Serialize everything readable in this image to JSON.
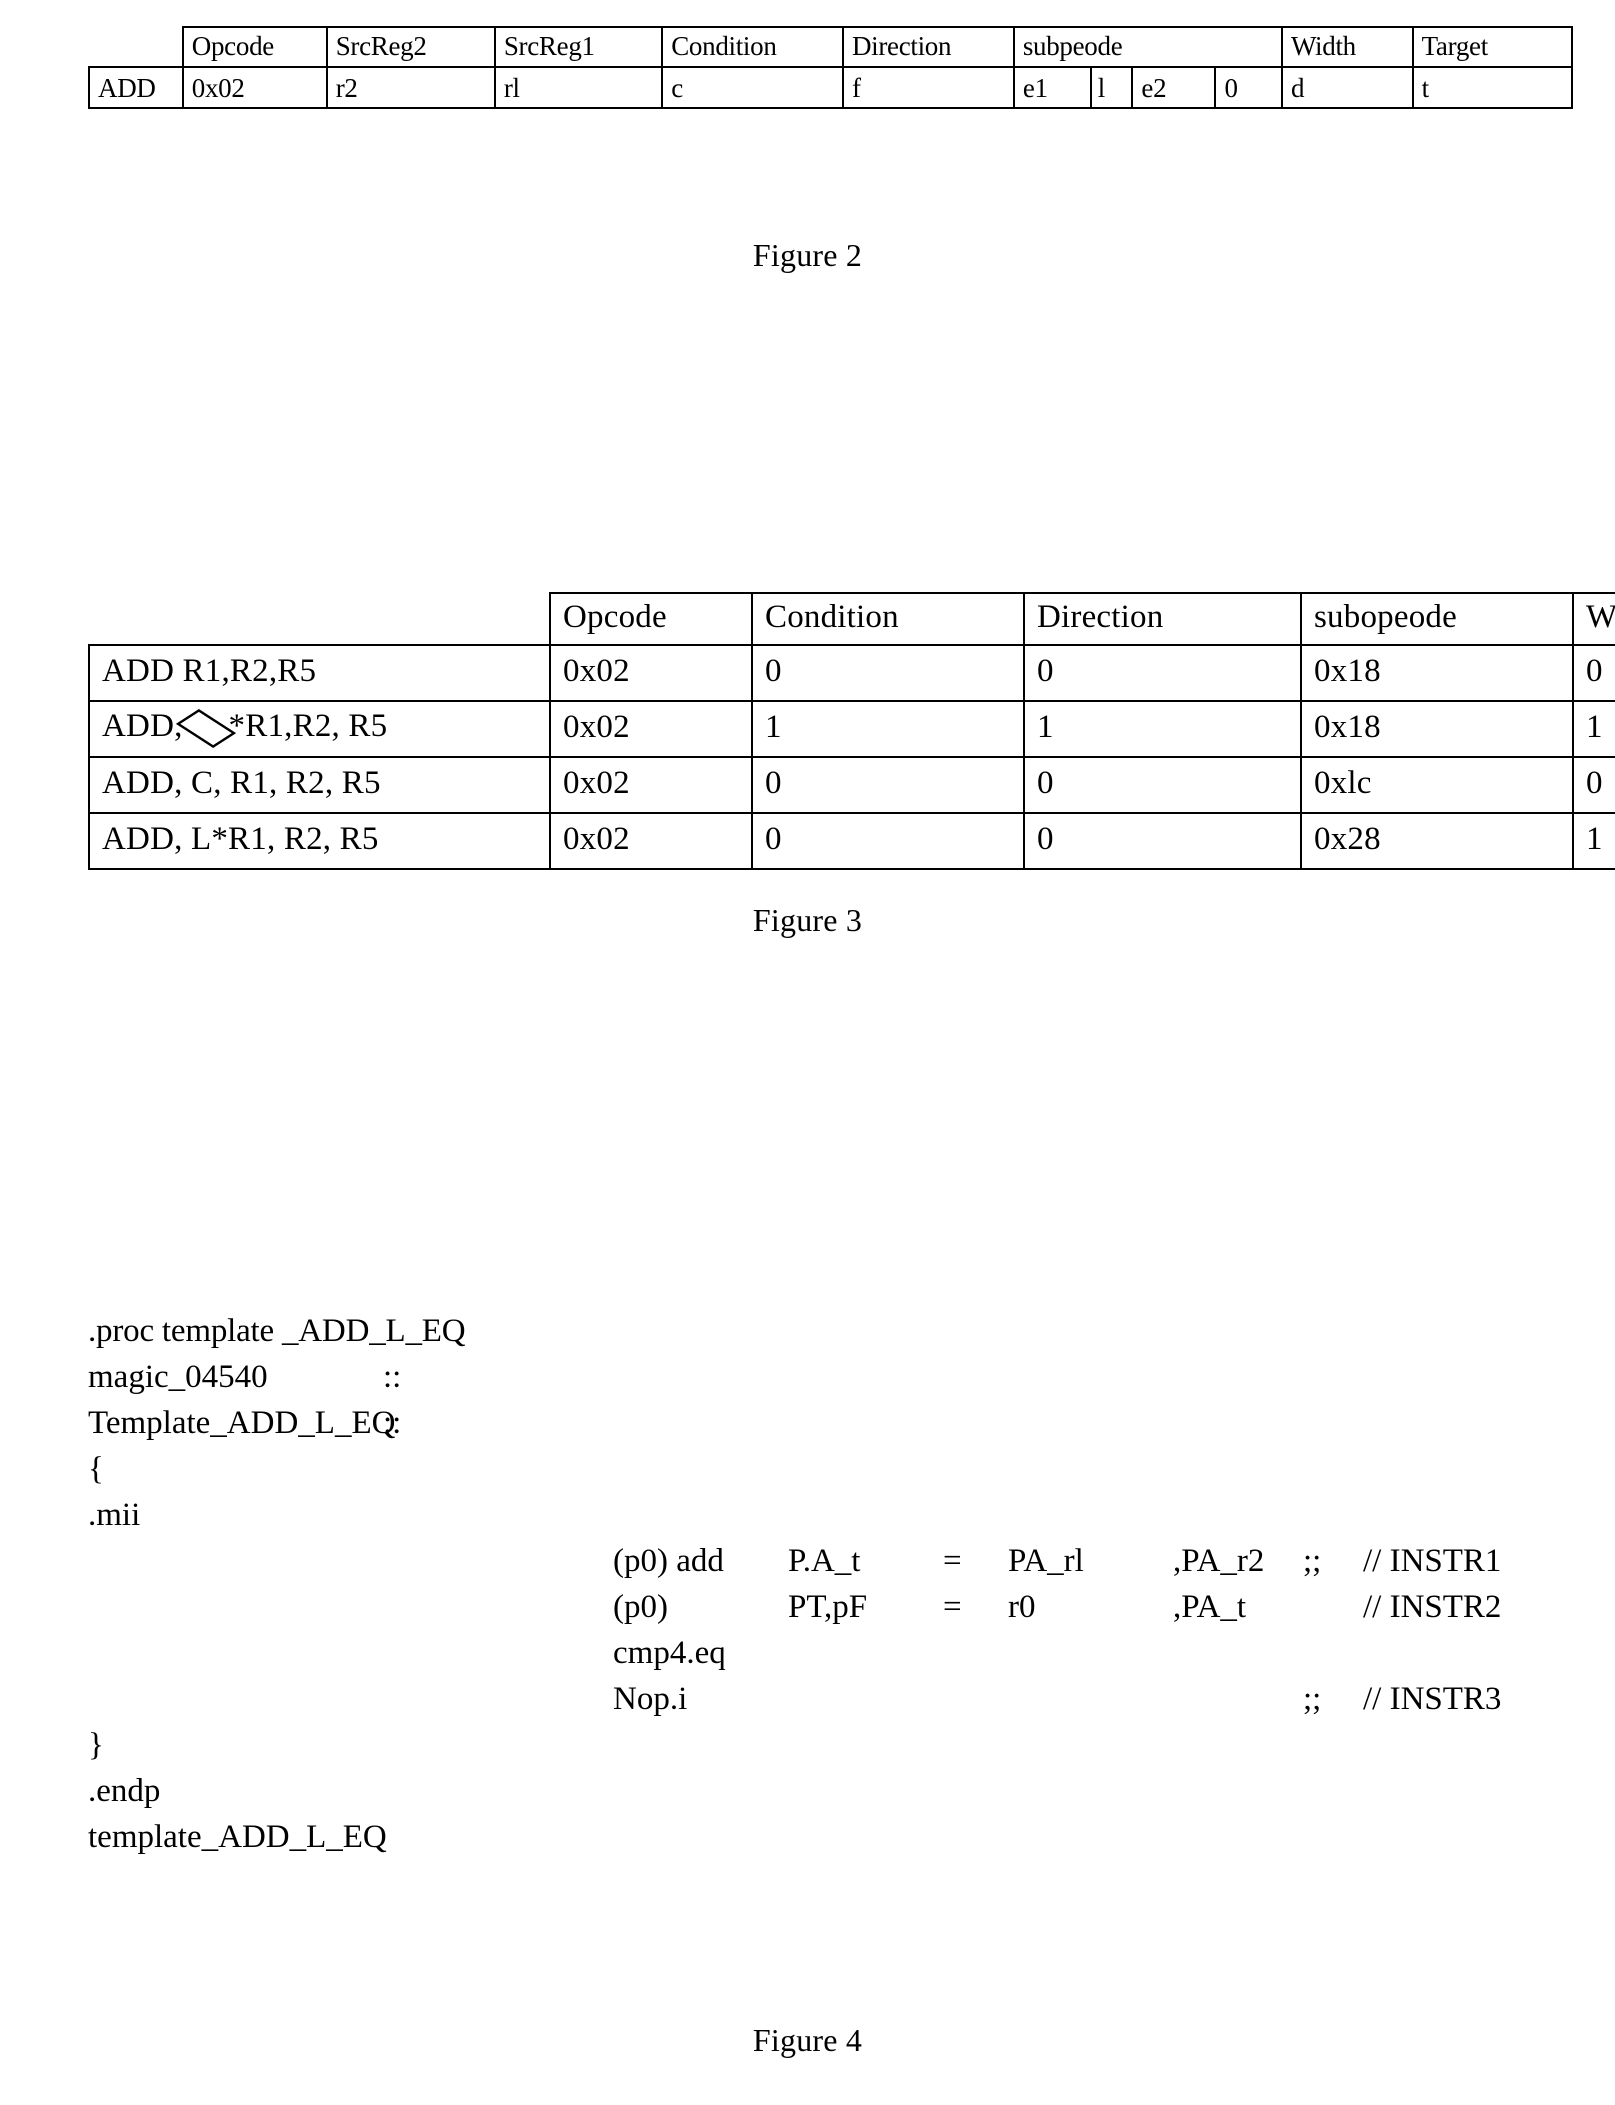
{
  "figure2": {
    "caption": "Figure 2",
    "columns": [
      "",
      "Opcode",
      "SrcReg2",
      "SrcReg1",
      "Condition",
      "Direction",
      "subpeode",
      "",
      "",
      "",
      "Width",
      "Target"
    ],
    "header": {
      "blank_left": "",
      "opcode": "Opcode",
      "srcreg2": "SrcReg2",
      "srcreg1": "SrcReg1",
      "condition": "Condition",
      "direction": "Direction",
      "subopcode": "subpeode",
      "width": "Width",
      "target": "Target"
    },
    "row": {
      "mnemonic": "ADD",
      "opcode": "0x02",
      "srcreg2": "r2",
      "srcreg1": "rl",
      "condition": "c",
      "direction": "f",
      "sub_e1": "e1",
      "sub_1": "l",
      "sub_e2": "e2",
      "sub_0": "0",
      "width": "d",
      "target": "t"
    }
  },
  "figure3": {
    "caption": "Figure 3",
    "columns": [
      "",
      "Opcode",
      "Condition",
      "Direction",
      "subopeode",
      "Width"
    ],
    "rows": [
      {
        "instruction": "ADD R1,R2,R5",
        "instruction_prefix": "ADD R1,R2,R5",
        "has_diamond": false,
        "opcode": "0x02",
        "condition": "0",
        "direction": "0",
        "subopcode": "0x18",
        "width": "0"
      },
      {
        "instruction": "ADD,  *R1,R2, R5",
        "instruction_prefix": "ADD,",
        "instruction_suffix": "*R1,R2, R5",
        "has_diamond": true,
        "opcode": "0x02",
        "condition": "1",
        "direction": "1",
        "subopcode": "0x18",
        "width": "1"
      },
      {
        "instruction": "ADD, C, R1, R2, R5",
        "instruction_prefix": "ADD, C, R1, R2, R5",
        "has_diamond": false,
        "opcode": "0x02",
        "condition": "0",
        "direction": "0",
        "subopcode": "0xlc",
        "width": "0"
      },
      {
        "instruction": "ADD, L*R1, R2, R5",
        "instruction_prefix": "ADD, L*R1, R2, R5",
        "has_diamond": false,
        "opcode": "0x02",
        "condition": "0",
        "direction": "0",
        "subopcode": "0x28",
        "width": "1"
      }
    ]
  },
  "figure4": {
    "caption": "Figure 4",
    "code_lines": [
      {
        "a": ".proc template _ADD_L_EQ"
      },
      {
        "a": "magic_04540",
        "b": "::"
      },
      {
        "a": "Template_ADD_L_EQ",
        "b": "::"
      },
      {
        "a": "{"
      },
      {
        "a": ".mii"
      },
      {
        "i1": "(p0) add",
        "i2": "P.A_t",
        "i3": "=",
        "i4": "PA_rl",
        "i5": ",PA_r2",
        "i6": ";;",
        "i7": "// INSTR1"
      },
      {
        "i1": "(p0)",
        "i2": "PT,pF",
        "i3": "=",
        "i4": "r0",
        "i5": ",PA_t",
        "i7": "// INSTR2"
      },
      {
        "i1": "cmp4.eq"
      },
      {
        "i1": "Nop.i",
        "i6": ";;",
        "i7": "// INSTR3"
      },
      {
        "a": "}"
      },
      {
        "a": ".endp"
      },
      {
        "a": "template_ADD_L_EQ"
      }
    ]
  }
}
